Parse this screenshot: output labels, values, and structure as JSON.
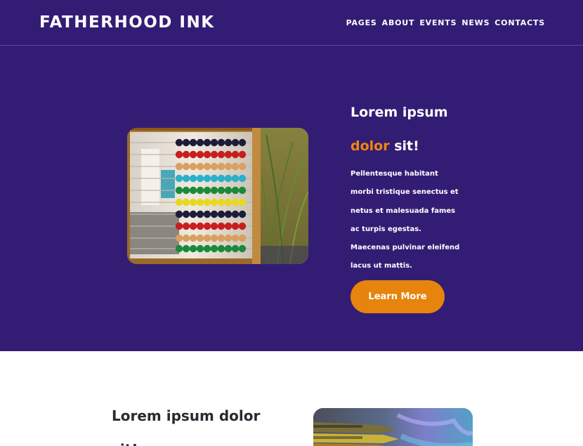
{
  "brand": {
    "logo_text": "FATHERHOOD INK"
  },
  "nav": {
    "items": [
      {
        "label": "PAGES"
      },
      {
        "label": "ABOUT"
      },
      {
        "label": "EVENTS"
      },
      {
        "label": "NEWS"
      },
      {
        "label": "CONTACTS"
      }
    ]
  },
  "hero": {
    "title_line1": "Lorem ipsum",
    "title_accent": "dolor",
    "title_end": "sit!",
    "body": "Pellentesque habitant morbi tristique senectus et netus et malesuada fames ac turpis egestas. Maecenas pulvinar eleifend lacus ut mattis.",
    "button_label": "Learn More",
    "image_subject": "abacus-photo"
  },
  "section2": {
    "title": "Lorem ipsum dolor sit!",
    "image_subject": "crayons-photo"
  },
  "colors": {
    "hero_background": "#331d74",
    "accent": "#f0860d",
    "button": "#e7840d",
    "heading_dark": "#2a2a33"
  }
}
